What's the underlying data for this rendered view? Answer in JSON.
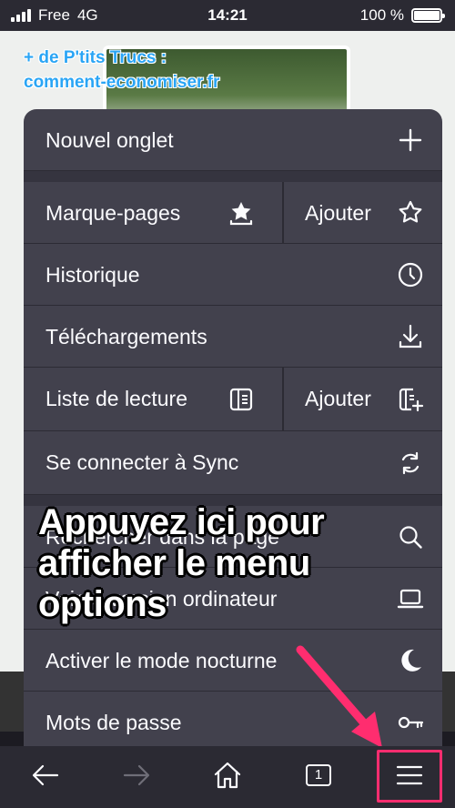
{
  "status_bar": {
    "carrier": "Free",
    "network": "4G",
    "time": "14:21",
    "battery": "100 %"
  },
  "webpage": {
    "watermark_line1": "+ de P'tits Trucs :",
    "watermark_line2": "comment-economiser.fr"
  },
  "menu": {
    "items": [
      {
        "label": "Nouvel onglet",
        "icon": "plus-icon"
      },
      {
        "label": "Marque-pages",
        "icon": "bookmark-icon",
        "secondary_label": "Ajouter",
        "secondary_icon": "star-icon"
      },
      {
        "label": "Historique",
        "icon": "clock-icon"
      },
      {
        "label": "Téléchargements",
        "icon": "download-icon"
      },
      {
        "label": "Liste de lecture",
        "icon": "reading-list-icon",
        "secondary_label": "Ajouter",
        "secondary_icon": "add-reading-list-icon"
      },
      {
        "label": "Se connecter à Sync",
        "icon": "sync-icon"
      },
      {
        "label": "Rechercher dans la page",
        "icon": "search-icon"
      },
      {
        "label": "Voir la version ordinateur",
        "icon": "laptop-icon"
      },
      {
        "label": "Activer le mode nocturne",
        "icon": "moon-icon"
      },
      {
        "label": "Mots de passe",
        "icon": "key-icon"
      }
    ]
  },
  "caption": {
    "text": "Appuyez ici pour afficher le menu options"
  },
  "toolbar": {
    "tab_count": "1"
  },
  "colors": {
    "menu_bg": "#42414d",
    "toolbar_bg": "#2b2a33",
    "highlight": "#ff2d6f",
    "watermark": "#2aa5f5"
  }
}
